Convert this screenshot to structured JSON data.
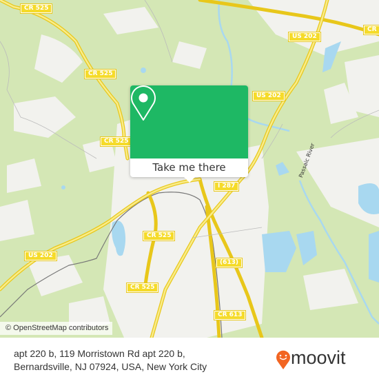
{
  "map": {
    "road_labels": [
      {
        "id": "cr525-a",
        "text": "CR 525"
      },
      {
        "id": "cr525-b",
        "text": "CR 525"
      },
      {
        "id": "cr525-c",
        "text": "CR 525"
      },
      {
        "id": "cr525-d",
        "text": "CR 525"
      },
      {
        "id": "cr525-e",
        "text": "CR 525"
      },
      {
        "id": "us202-a",
        "text": "US 202"
      },
      {
        "id": "us202-b",
        "text": "US 202"
      },
      {
        "id": "us202-c",
        "text": "US 202"
      },
      {
        "id": "cr-top-right",
        "text": "CR"
      },
      {
        "id": "i287",
        "text": "I 287"
      },
      {
        "id": "r613",
        "text": "(613)"
      },
      {
        "id": "cr613",
        "text": "CR 613"
      }
    ],
    "river_label": "Passaic River",
    "attribution": "© OpenStreetMap contributors",
    "colors": {
      "woodland": "#d4e7b5",
      "urban": "#f2f2ee",
      "water": "#a8d8f0",
      "road": "#f5db2a",
      "rail": "#777777"
    }
  },
  "popup": {
    "icon": "map-pin-icon",
    "button_label": "Take me there",
    "accent_color": "#1eb864"
  },
  "footer": {
    "address_line1": "apt 220 b, 119 Morristown Rd apt 220 b,",
    "address_line2": "Bernardsville, NJ 07924, USA, New York City",
    "brand": "moovit",
    "brand_color": "#f26522"
  }
}
